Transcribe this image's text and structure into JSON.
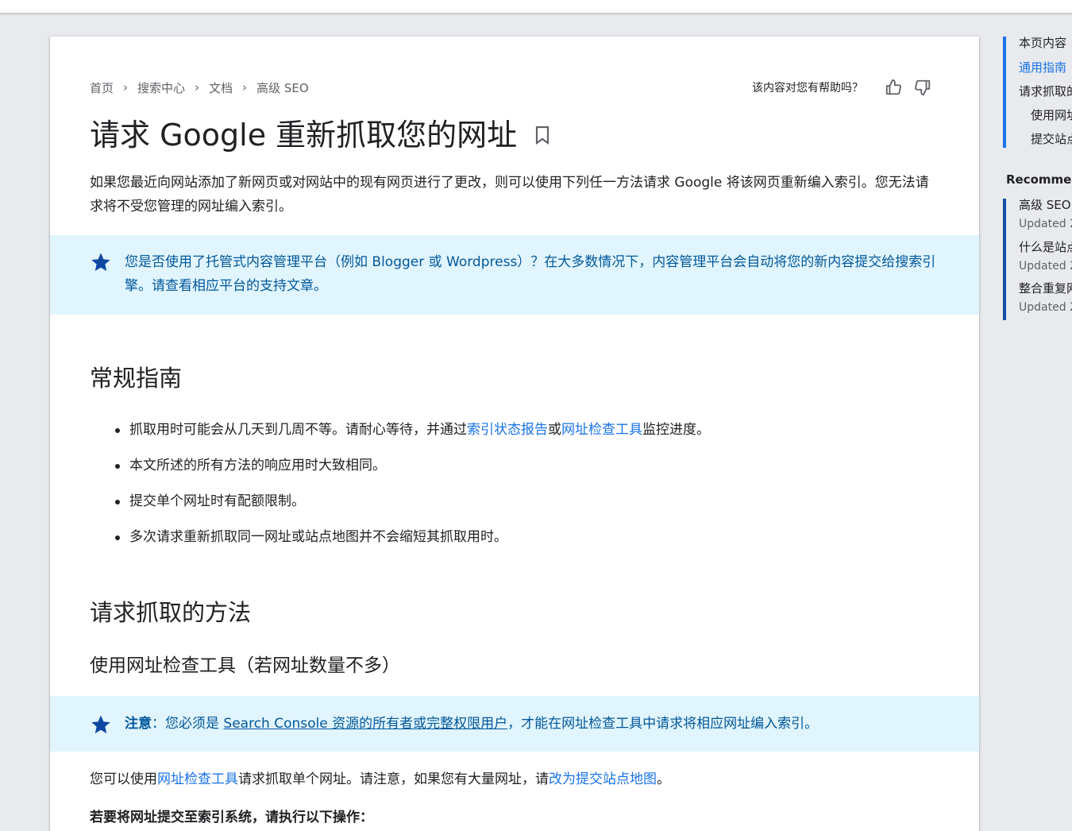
{
  "breadcrumb": [
    "首页",
    "搜索中心",
    "文档",
    "高级 SEO"
  ],
  "feedback": {
    "label": "该内容对您有帮助吗？"
  },
  "page": {
    "title": "请求 Google 重新抓取您的网址",
    "intro": "如果您最近向网站添加了新网页或对网站中的现有网页进行了更改，则可以使用下列任一方法请求 Google 将该网页重新编入索引。您无法请求将不受您管理的网址编入索引。"
  },
  "note1": {
    "text": "您是否使用了托管式内容管理平台（例如 Blogger 或 Wordpress）？在大多数情况下，内容管理平台会自动将您的新内容提交给搜索引擎。请查看相应平台的支持文章。"
  },
  "sections": {
    "general": "常规指南",
    "methods": "请求抓取的方法",
    "url_inspection": "使用网址检查工具（若网址数量不多）"
  },
  "guidelines": {
    "item1_before": "抓取用时可能会从几天到几周不等。请耐心等待，并通过",
    "item1_link1": "索引状态报告",
    "item1_mid": "或",
    "item1_link2": "网址检查工具",
    "item1_after": "监控进度。",
    "item2": "本文所述的所有方法的响应用时大致相同。",
    "item3": "提交单个网址时有配额限制。",
    "item4": "多次请求重新抓取同一网址或站点地图并不会缩短其抓取用时。"
  },
  "note2": {
    "label": "注意",
    "colon": "：您必须是 ",
    "link": "Search Console 资源的所有者或完整权限用户",
    "rest": "，才能在网址检查工具中请求将相应网址编入索引。"
  },
  "paragraph": {
    "before": "您可以使用",
    "link1": "网址检查工具",
    "mid": "请求抓取单个网址。请注意，如果您有大量网址，请",
    "link2": "改为提交站点地图",
    "after": "。"
  },
  "steps_heading": "若要将网址提交至索引系统，请执行以下操作：",
  "toc": {
    "heading": "本页内容",
    "items": [
      "通用指南",
      "请求抓取的方法",
      "使用网址检查工具",
      "提交站点地图"
    ]
  },
  "recommended": {
    "heading": "Recommended",
    "items": [
      {
        "title": "高级 SEO",
        "date": "Updated 2"
      },
      {
        "title": "什么是站点地图",
        "date": "Updated 2"
      },
      {
        "title": "整合重复网址",
        "date": "Updated 2"
      }
    ]
  },
  "colors": {
    "accent": "#1a73e8",
    "note_bg": "#e1f5fe",
    "note_text": "#01579b"
  }
}
